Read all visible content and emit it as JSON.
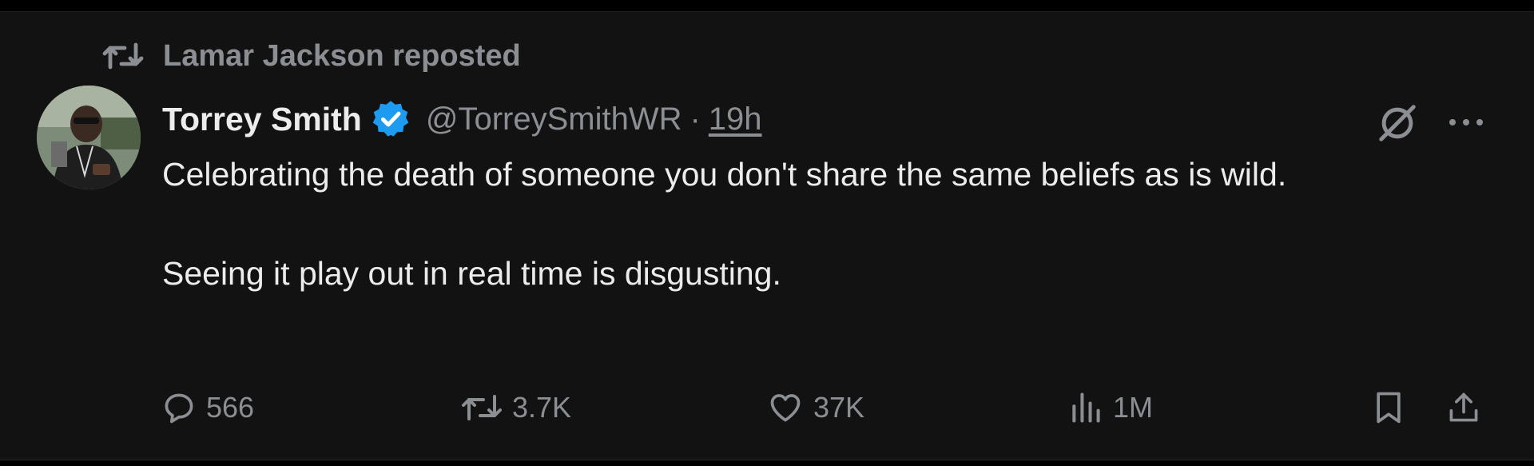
{
  "repost": {
    "text": "Lamar Jackson reposted",
    "icon": "repost-icon"
  },
  "tweet": {
    "author_name": "Torrey Smith",
    "verified_icon": "verified-badge-icon",
    "handle": "@TorreySmithWR",
    "separator": "·",
    "timestamp": "19h",
    "text_line_1": "Celebrating the death of someone you don't share the same beliefs as is wild.",
    "text_line_2": "Seeing it play out in real time is disgusting."
  },
  "actions": {
    "reply_count": "566",
    "repost_count": "3.7K",
    "like_count": "37K",
    "view_count": "1M"
  },
  "colors": {
    "background": "#121212",
    "primary_text": "#ececec",
    "secondary_text": "#8b8f94",
    "verified_blue": "#1d9bf0"
  }
}
